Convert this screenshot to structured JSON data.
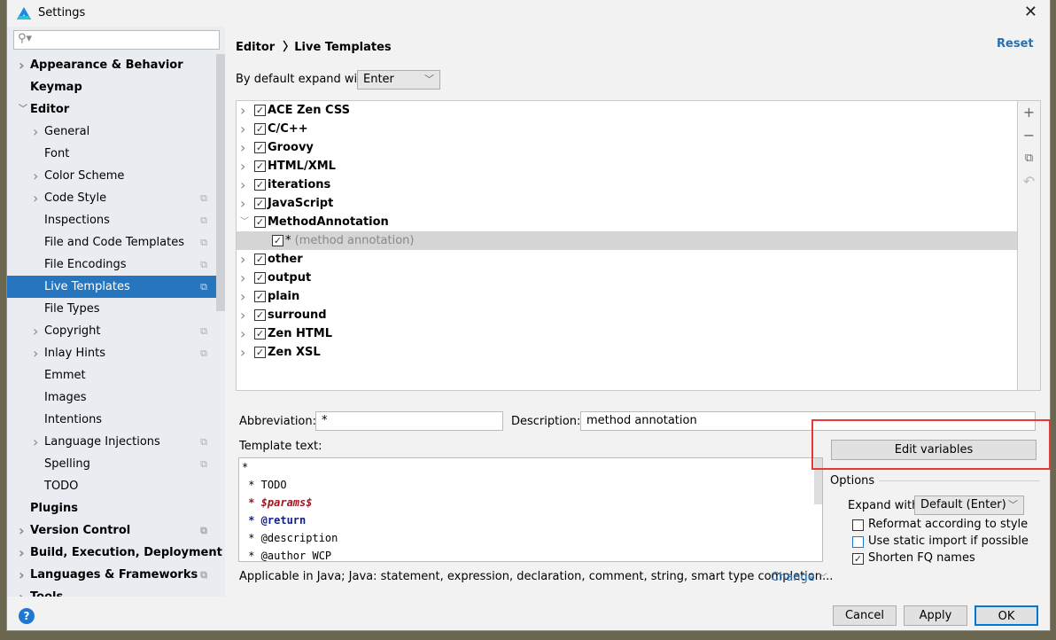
{
  "window": {
    "title": "Settings",
    "close_icon": "close-icon",
    "logo_icon": "app-logo-icon"
  },
  "sidebar": {
    "search_placeholder": "",
    "items": [
      {
        "label": "Appearance & Behavior",
        "bold": true,
        "level": 0,
        "expander": "collapsed",
        "copy": false
      },
      {
        "label": "Keymap",
        "bold": true,
        "level": 0,
        "expander": "none",
        "copy": false
      },
      {
        "label": "Editor",
        "bold": true,
        "level": 0,
        "expander": "expanded",
        "copy": false
      },
      {
        "label": "General",
        "level": 1,
        "expander": "collapsed",
        "copy": false
      },
      {
        "label": "Font",
        "level": 1,
        "expander": "none",
        "copy": false
      },
      {
        "label": "Color Scheme",
        "level": 1,
        "expander": "collapsed",
        "copy": false
      },
      {
        "label": "Code Style",
        "level": 1,
        "expander": "collapsed",
        "copy": true
      },
      {
        "label": "Inspections",
        "level": 1,
        "expander": "none",
        "copy": true
      },
      {
        "label": "File and Code Templates",
        "level": 1,
        "expander": "none",
        "copy": true
      },
      {
        "label": "File Encodings",
        "level": 1,
        "expander": "none",
        "copy": true
      },
      {
        "label": "Live Templates",
        "level": 1,
        "expander": "none",
        "copy": true,
        "selected": true
      },
      {
        "label": "File Types",
        "level": 1,
        "expander": "none",
        "copy": false
      },
      {
        "label": "Copyright",
        "level": 1,
        "expander": "collapsed",
        "copy": true
      },
      {
        "label": "Inlay Hints",
        "level": 1,
        "expander": "collapsed",
        "copy": true
      },
      {
        "label": "Emmet",
        "level": 1,
        "expander": "none",
        "copy": false
      },
      {
        "label": "Images",
        "level": 1,
        "expander": "none",
        "copy": false
      },
      {
        "label": "Intentions",
        "level": 1,
        "expander": "none",
        "copy": false
      },
      {
        "label": "Language Injections",
        "level": 1,
        "expander": "collapsed",
        "copy": true
      },
      {
        "label": "Spelling",
        "level": 1,
        "expander": "none",
        "copy": true
      },
      {
        "label": "TODO",
        "level": 1,
        "expander": "none",
        "copy": false
      },
      {
        "label": "Plugins",
        "bold": true,
        "level": 0,
        "expander": "none",
        "copy": false
      },
      {
        "label": "Version Control",
        "bold": true,
        "level": 0,
        "expander": "collapsed",
        "copy": true
      },
      {
        "label": "Build, Execution, Deployment",
        "bold": true,
        "level": 0,
        "expander": "collapsed",
        "copy": false
      },
      {
        "label": "Languages & Frameworks",
        "bold": true,
        "level": 0,
        "expander": "collapsed",
        "copy": true
      },
      {
        "label": "Tools",
        "bold": true,
        "level": 0,
        "expander": "collapsed",
        "copy": false
      }
    ]
  },
  "header": {
    "breadcrumb": [
      "Editor",
      "Live Templates"
    ],
    "reset": "Reset"
  },
  "expand": {
    "label": "By default expand with",
    "value": "Enter"
  },
  "tree": [
    {
      "label": "ACE Zen CSS",
      "checked": true
    },
    {
      "label": "C/C++",
      "checked": true
    },
    {
      "label": "Groovy",
      "checked": true
    },
    {
      "label": "HTML/XML",
      "checked": true
    },
    {
      "label": "iterations",
      "checked": true
    },
    {
      "label": "JavaScript",
      "checked": true
    },
    {
      "label": "MethodAnnotation",
      "checked": true,
      "expanded": true
    },
    {
      "label": "*",
      "desc": " (method annotation)",
      "checked": true,
      "child": true,
      "selected": true
    },
    {
      "label": "other",
      "checked": true
    },
    {
      "label": "output",
      "checked": true
    },
    {
      "label": "plain",
      "checked": true
    },
    {
      "label": "surround",
      "checked": true
    },
    {
      "label": "Zen HTML",
      "checked": true
    },
    {
      "label": "Zen XSL",
      "checked": true
    }
  ],
  "toolbar": [
    "add-icon",
    "remove-icon",
    "copy-icon",
    "revert-icon"
  ],
  "form": {
    "abbreviation_label": "Abbreviation:",
    "abbreviation": "*",
    "description_label": "Description:",
    "description": "method annotation",
    "template_label": "Template text:",
    "edit_variables": "Edit variables",
    "template_lines": [
      {
        "text": "*",
        "style": ""
      },
      {
        "text": " * TODO",
        "style": ""
      },
      {
        "text": " * $params$",
        "style": "var"
      },
      {
        "text": " * @return",
        "style": "tag"
      },
      {
        "text": " * @description",
        "style": ""
      },
      {
        "text": " * @author WCP",
        "style": ""
      }
    ],
    "applicable": "Applicable in Java; Java: statement, expression, declaration, comment, string, smart type completion...",
    "change": "Change"
  },
  "options": {
    "title": "Options",
    "expand_with_label": "Expand with",
    "expand_with": "Default (Enter)",
    "reformat": {
      "label": "Reformat according to style",
      "checked": false
    },
    "static_import": {
      "label": "Use static import if possible",
      "checked": false
    },
    "shorten": {
      "label": "Shorten FQ names",
      "checked": true
    }
  },
  "buttons": {
    "cancel": "Cancel",
    "apply": "Apply",
    "ok": "OK"
  },
  "colors": {
    "accent": "#2675bf",
    "highlight_box": "#e53935",
    "link": "#2470b3"
  }
}
